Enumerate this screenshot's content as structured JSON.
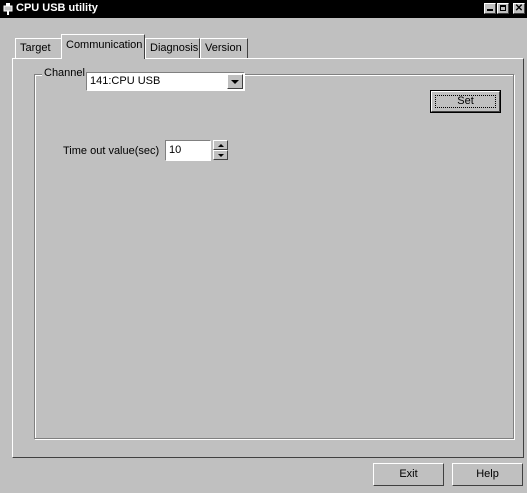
{
  "window": {
    "title": "CPU USB utility"
  },
  "tabs": [
    {
      "label": "Target"
    },
    {
      "label": "Communication",
      "active": true
    },
    {
      "label": "Diagnosis"
    },
    {
      "label": "Version"
    }
  ],
  "communication": {
    "channel_label": "Channel",
    "channel_value": "141:CPU USB",
    "set_label": "Set",
    "timeout_label": "Time out value(sec)",
    "timeout_value": "10"
  },
  "footer": {
    "exit_label": "Exit",
    "help_label": "Help"
  },
  "icons": {
    "app": "usb-plug-icon",
    "minimize": "minimize-icon",
    "maximize": "maximize-icon",
    "close": "close-icon",
    "dropdown": "chevron-down-icon",
    "spin_up": "spin-up-icon",
    "spin_down": "spin-down-icon"
  },
  "colors": {
    "face": "#c0c0c0",
    "titlebar": "#000000",
    "field": "#ffffff"
  }
}
